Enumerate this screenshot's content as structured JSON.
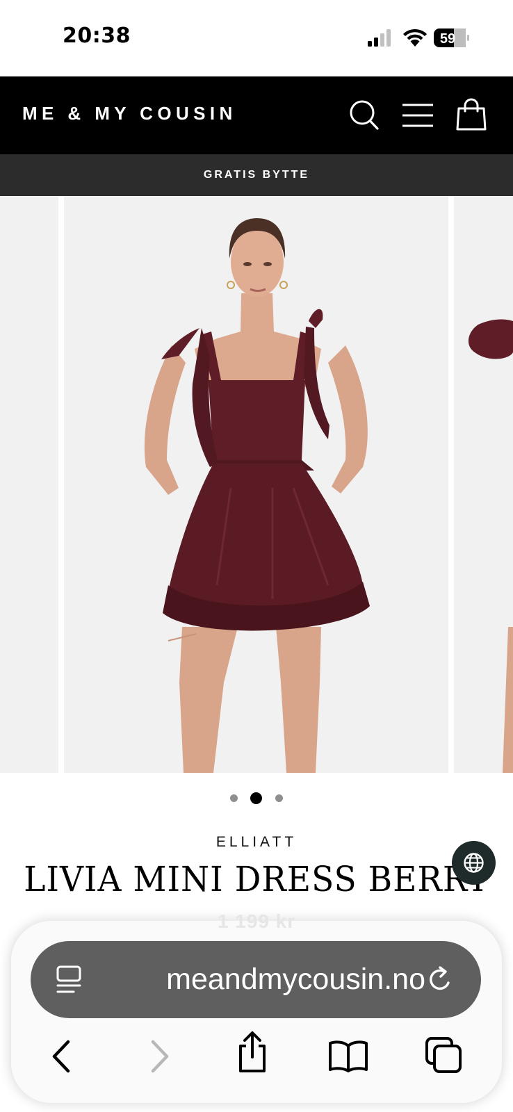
{
  "status_bar": {
    "time": "20:38",
    "battery": "59",
    "icons": [
      "cellular-signal-icon",
      "wifi-icon",
      "battery-icon"
    ]
  },
  "header": {
    "logo": "ME & MY COUSIN",
    "icons": [
      "search-icon",
      "menu-icon",
      "shopping-bag-icon"
    ]
  },
  "promo": {
    "text": "GRATIS BYTTE"
  },
  "gallery": {
    "slide_count": 3,
    "active_slide": 2,
    "zoom_icon": "magnifier-icon"
  },
  "product": {
    "brand": "ELLIATT",
    "title": "LIVIA MINI DRESS BERRY",
    "price_partial": "1 199 kr"
  },
  "browser": {
    "url": "meandmycousin.no",
    "page_menu_icon": "page-menu-icon",
    "reload_icon": "reload-icon",
    "toolbar_icons": [
      "back-icon",
      "forward-icon",
      "share-icon",
      "bookmarks-icon",
      "tabs-icon"
    ]
  },
  "colors": {
    "header_bg": "#000000",
    "promo_bg": "#2c2c2c",
    "dress": "#5e1d27",
    "image_bg": "#f1f1f1",
    "url_bar": "#5f5f5f"
  }
}
